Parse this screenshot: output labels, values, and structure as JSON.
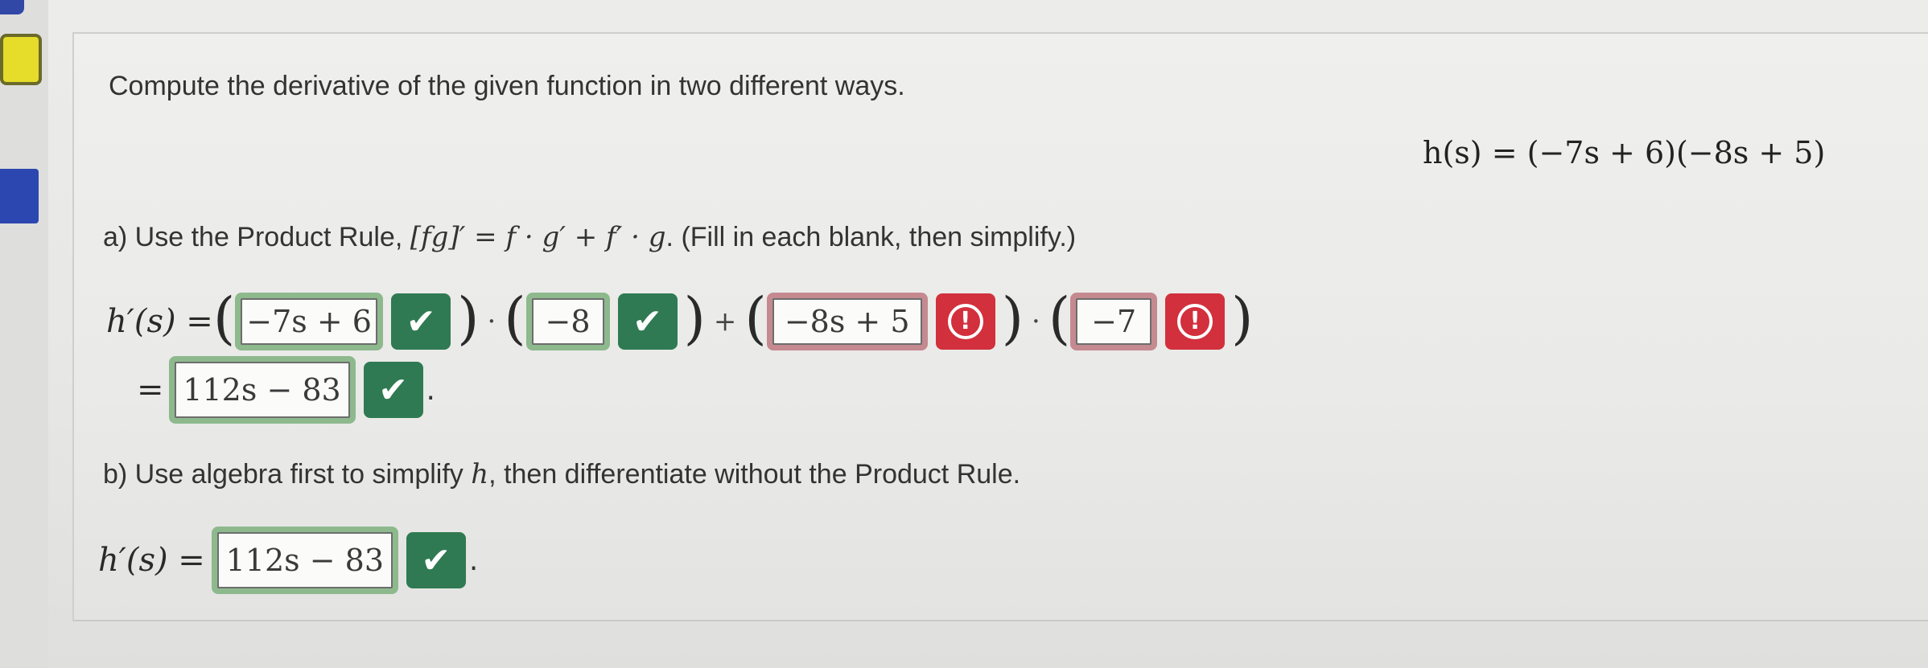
{
  "question": {
    "prompt": "Compute the derivative of the given function in two different ways.",
    "function": "h(s) = (−7s + 6)(−8s + 5)"
  },
  "part_a": {
    "instruction_prefix": "a) Use the Product Rule, ",
    "rule": "[fg]′ = f · g′ + f′ · g",
    "instruction_suffix": ". (Fill in each blank, then simplify.)",
    "lhs": "h′(s) =",
    "eq_sign": "=",
    "dot_op": "·",
    "plus_op": "+",
    "open_paren": "(",
    "close_paren": ")",
    "blanks": [
      {
        "value": "−7s + 6",
        "status": "correct"
      },
      {
        "value": "−8",
        "status": "correct"
      },
      {
        "value": "−8s + 5",
        "status": "incorrect"
      },
      {
        "value": "−7",
        "status": "incorrect"
      }
    ],
    "simplified": {
      "value": "112s − 83",
      "status": "correct"
    }
  },
  "part_b": {
    "instruction_prefix": "b) Use algebra first to simplify ",
    "variable": "h",
    "instruction_suffix": ", then differentiate without the Product Rule.",
    "lhs": "h′(s) =",
    "answer": {
      "value": "112s − 83",
      "status": "correct"
    }
  },
  "icons": {
    "correct": "checkmark-icon",
    "incorrect": "alert-icon"
  },
  "glyphs": {
    "check": "✔",
    "alert": "!",
    "period": "."
  },
  "colors": {
    "correct_badge": "#2f7a52",
    "incorrect_badge": "#d2303c",
    "correct_border": "#8db98d",
    "incorrect_border": "#c48a8f"
  }
}
